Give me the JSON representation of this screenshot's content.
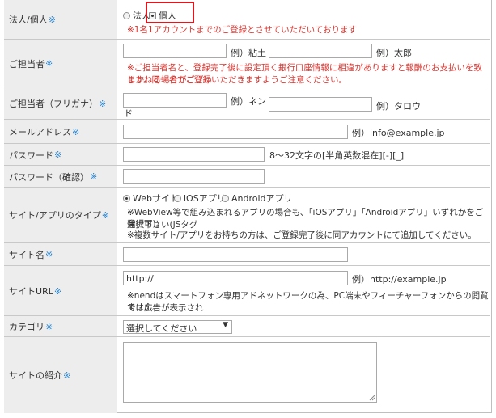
{
  "rows": {
    "corp": {
      "label": "法人/個人",
      "req": "※",
      "opt_corp": "法人",
      "opt_indiv": "個人",
      "note": "※1名1アカウントまでのご登録とさせていただいております"
    },
    "person": {
      "label": "ご担当者",
      "req": "※",
      "ex_last": "例）粘土",
      "ex_first": "例）太郎",
      "note1": "※ご担当者名と、登録完了後に設定頂く銀行口座情報に相違がありますと報酬のお支払いを致しかねる場合がござい",
      "note2": "ます。同一名でご登録いただきますようご注意ください。"
    },
    "kana": {
      "label": "ご担当者（フリガナ）",
      "req": "※",
      "ex_last1": "例）ネン",
      "ex_last2": "ド",
      "ex_first": "例）タロウ"
    },
    "email": {
      "label": "メールアドレス",
      "req": "※",
      "example": "例）info@example.jp"
    },
    "password": {
      "label": "パスワード",
      "req": "※",
      "hint": "8～32文字の[半角英数混在][-][_]"
    },
    "password_confirm": {
      "label": "パスワード（確認）",
      "req": "※"
    },
    "site_type": {
      "label": "サイト/アプリのタイプ",
      "req": "※",
      "opt_web": "Webサイト",
      "opt_ios": "iOSアプリ",
      "opt_android": "Androidアプリ",
      "note1": "※WebView等で組み込まれるアプリの場合も、「iOSアプリ」「Androidアプリ」いずれかをご選択下さい(JSタグ",
      "note2": "発行可)。",
      "note3": "※複数サイト/アプリをお持ちの方は、ご登録完了後に同アカウントにて追加してください。"
    },
    "site_name": {
      "label": "サイト名",
      "req": "※"
    },
    "site_url": {
      "label": "サイトURL",
      "req": "※",
      "value": "http://",
      "example": "例）http://example.jp",
      "note1": "※nendはスマートフォン専用アドネットワークの為、PC端末やフィーチャーフォンからの閲覧では広告が表示され",
      "note2": "ません。"
    },
    "category": {
      "label": "カテゴリ",
      "req": "※",
      "selected": "選択してください"
    },
    "site_intro": {
      "label": "サイトの紹介",
      "req": "※"
    }
  },
  "colors": {
    "label_bg": "#ededed",
    "required": "#2b8ad8",
    "warning": "#d9352f",
    "highlight_box": "#d8191f"
  },
  "icons": {
    "dropdown": "triangle-down",
    "radio": "radio-button"
  }
}
